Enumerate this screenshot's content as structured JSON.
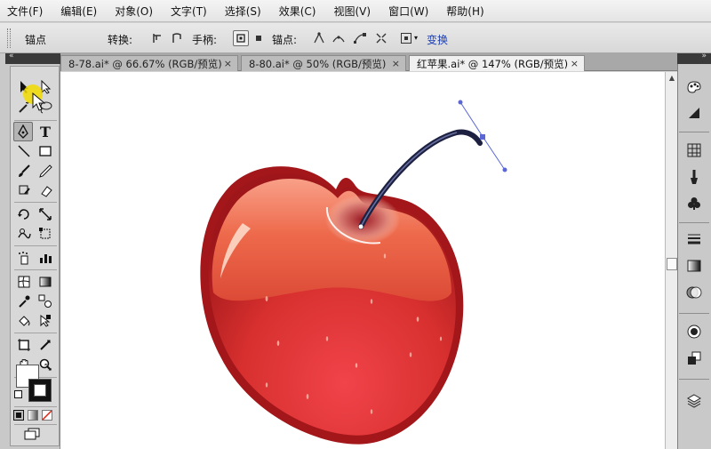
{
  "menu": [
    "文件(F)",
    "编辑(E)",
    "对象(O)",
    "文字(T)",
    "选择(S)",
    "效果(C)",
    "视图(V)",
    "窗口(W)",
    "帮助(H)"
  ],
  "control": {
    "anchor_label": "锚点",
    "convert_label": "转换:",
    "handles_label": "手柄:",
    "anchors_label": "锚点:",
    "transform_label": "变换"
  },
  "tabs": [
    {
      "label": "8-78.ai* @ 66.67% (RGB/预览)",
      "active": false
    },
    {
      "label": "8-80.ai* @ 50% (RGB/预览)",
      "active": false
    },
    {
      "label": "红苹果.ai* @ 147% (RGB/预览)",
      "active": true
    }
  ],
  "tab_close_glyph": "×",
  "tools": [
    "selection-tool",
    "direct-selection-tool",
    "magic-wand-tool",
    "lasso-tool",
    "pen-tool",
    "type-tool",
    "line-segment-tool",
    "rectangle-tool",
    "paintbrush-tool",
    "pencil-tool",
    "blob-brush-tool",
    "eraser-tool",
    "rotate-tool",
    "scale-tool",
    "warp-tool",
    "free-transform-tool",
    "symbol-sprayer-tool",
    "column-graph-tool",
    "mesh-tool",
    "gradient-tool",
    "eyedropper-tool",
    "blend-tool",
    "live-paint-bucket-tool",
    "live-paint-selection-tool",
    "artboard-tool",
    "slice-tool",
    "hand-tool",
    "zoom-tool"
  ],
  "type_tool_glyph": "T",
  "panel_collapse_glyph": "«",
  "panel_expand_glyph": "»",
  "scroll_up_glyph": "▲",
  "scroll_down_glyph": "▼",
  "right_panel_icons": [
    "color-icon",
    "color-guide-icon",
    "swatches-icon",
    "brushes-icon",
    "symbols-icon",
    "stroke-icon",
    "gradient-icon",
    "transparency-icon",
    "appearance-icon",
    "graphic-styles-icon",
    "layers-icon"
  ],
  "colors": {
    "apple_dark": "#a3161a",
    "apple_mid": "#dd3b36",
    "apple_light": "#f06a4a",
    "stem": "#1d2040",
    "handle_line": "#5b67d4",
    "accent_link": "#1c3fb5"
  }
}
